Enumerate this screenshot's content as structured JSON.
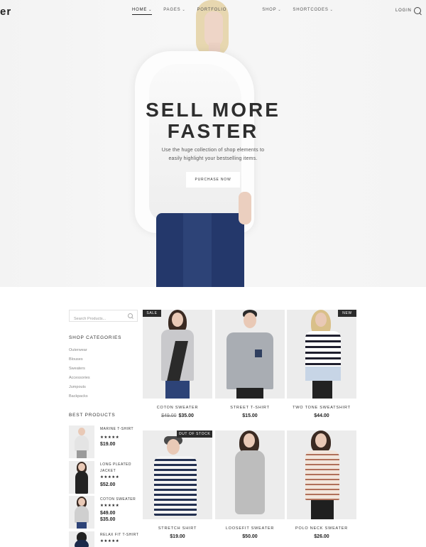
{
  "header": {
    "logo": "er",
    "nav": [
      {
        "label": "HOME",
        "chev": "⌄"
      },
      {
        "label": "PAGES",
        "chev": "⌄"
      },
      {
        "label": "PORTFOLIO",
        "chev": ""
      },
      {
        "label": "",
        "chev": ""
      },
      {
        "label": "SHOP",
        "chev": "⌄"
      },
      {
        "label": "SHORTCODES",
        "chev": "⌄"
      }
    ],
    "login": "LOGIN",
    "search_icon": "search-icon"
  },
  "hero": {
    "title_line1": "SELL MORE",
    "title_line2": "FASTER",
    "subtitle_line1": "Use the huge collection of shop elements to",
    "subtitle_line2": "easily highlight your bestselling items.",
    "button": "PURCHASE NOW"
  },
  "sidebar": {
    "search_placeholder": "Search Products...",
    "categories_heading": "SHOP CATEGORIES",
    "categories": [
      "Outerwear",
      "Blouses",
      "Sweaters",
      "Accessories",
      "Jumpouts",
      "Backpacks"
    ],
    "best_heading": "BEST PRODUCTS",
    "best_products": [
      {
        "name": "MARINE T-SHIRT",
        "stars": "★★★★★",
        "price": "$19.00"
      },
      {
        "name": "LONG PLEATED JACKET",
        "stars": "★★★★★",
        "price": "$52.00"
      },
      {
        "name": "COTON SWEATER",
        "stars": "★★★★★",
        "price": "$49.00",
        "price2": "$35.00"
      },
      {
        "name": "RELAX FIT T-SHIRT",
        "stars": "★★★★★",
        "price": ""
      }
    ]
  },
  "products": [
    {
      "name": "COTON SWEATER",
      "old_price": "$49.00",
      "price": "$35.00",
      "badge": "SALE"
    },
    {
      "name": "STREET T-SHIRT",
      "old_price": "",
      "price": "$15.00",
      "badge": ""
    },
    {
      "name": "TWO TONE SWEATSHIRT",
      "old_price": "",
      "price": "$44.00",
      "badge": "NEW"
    },
    {
      "name": "STRETCH SHIRT",
      "old_price": "",
      "price": "$19.00",
      "badge": "OUT OF STOCK"
    },
    {
      "name": "LOOSEFIT SWEATER",
      "old_price": "",
      "price": "$50.00",
      "badge": ""
    },
    {
      "name": "POLO NECK SWEATER",
      "old_price": "",
      "price": "$26.00",
      "badge": ""
    }
  ],
  "colors": {
    "accent": "#2b2b2b",
    "hero_bg": "#f5f5f5",
    "denim": "#24386b"
  }
}
